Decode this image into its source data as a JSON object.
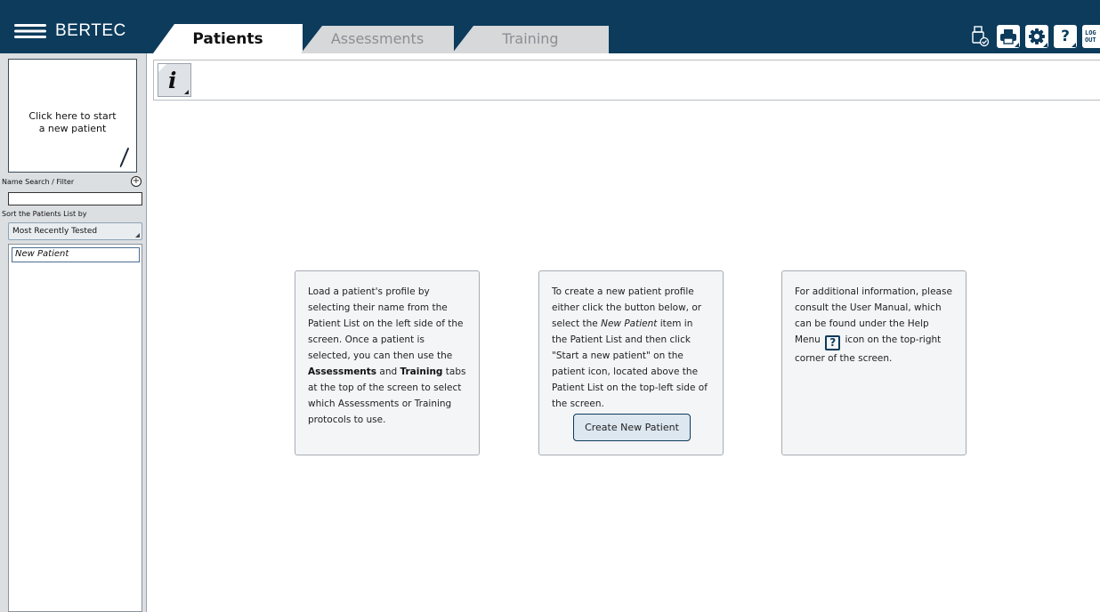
{
  "app": {
    "brand": "BERTEC",
    "colors": {
      "header_bg": "#0c3b5c",
      "sidebar_bg": "#dcdfe2",
      "accent": "#0c3b5c"
    }
  },
  "tabs": [
    {
      "label": "Patients",
      "active": true
    },
    {
      "label": "Assessments",
      "active": false
    },
    {
      "label": "Training",
      "active": false
    }
  ],
  "toolbar": {
    "icons": [
      "usb-icon",
      "printer-icon",
      "settings-icon",
      "help-icon",
      "logout-icon"
    ],
    "logout_line1": "LOG",
    "logout_line2": "OUT"
  },
  "sidebar": {
    "new_patient_card": {
      "line1": "Click here to start",
      "line2": "a new patient"
    },
    "search": {
      "label": "Name Search / Filter",
      "value": ""
    },
    "sort": {
      "label": "Sort the Patients List by",
      "selected": "Most Recently Tested"
    },
    "patients": [
      "New Patient"
    ]
  },
  "info_bar": {
    "icon": "info-icon",
    "glyph": "i"
  },
  "cards": {
    "load": {
      "t1": "Load a patient's profile by selecting their name from the Patient List on the left side of the screen. Once a patient is selected, you can then use the ",
      "b1": "Assessments",
      "t2": " and ",
      "b2": "Training",
      "t3": " tabs at the top of the screen to select which Assessments or Training protocols to use."
    },
    "create": {
      "t1": "To create a new patient profile either click the button below, or select the ",
      "i1": "New Patient",
      "t2": " item in the Patient List and then click \"Start a new patient\" on the patient icon, located above the Patient List on the top-left side of the screen.",
      "button": "Create New Patient"
    },
    "help": {
      "t1": "For additional information, please consult the User Manual, which can be found under the Help Menu ",
      "icon_glyph": "?",
      "t2": " icon on the top-right corner of the screen."
    }
  }
}
